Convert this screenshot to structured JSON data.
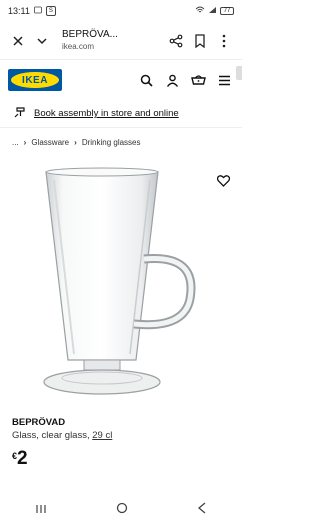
{
  "status_bar": {
    "time": "13:11",
    "badge": "S",
    "battery": "77"
  },
  "browser": {
    "page_title": "BEPRÖVA...",
    "url": "ikea.com"
  },
  "header": {
    "logo_text": "IKEA"
  },
  "promo": {
    "text": "Book assembly in store and online"
  },
  "breadcrumb": {
    "ellipsis": "...",
    "items": [
      "Glassware",
      "Drinking glasses"
    ]
  },
  "product": {
    "name": "BEPRÖVAD",
    "desc_prefix": "Glass, clear glass, ",
    "volume": "29 cl",
    "currency": "€",
    "price": "2"
  },
  "colors": {
    "ikea_blue": "#0058a3",
    "ikea_yellow": "#ffdb00"
  }
}
